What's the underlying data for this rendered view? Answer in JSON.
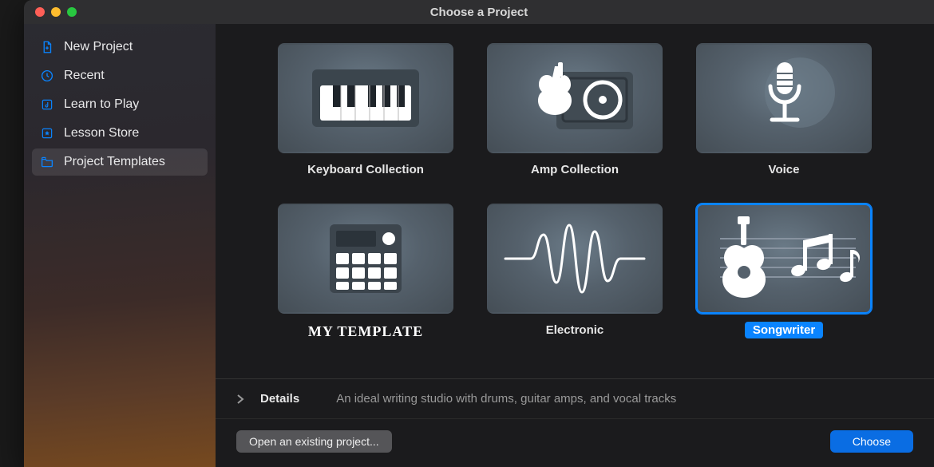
{
  "window": {
    "title": "Choose a Project"
  },
  "sidebar": {
    "items": [
      {
        "label": "New Project"
      },
      {
        "label": "Recent"
      },
      {
        "label": "Learn to Play"
      },
      {
        "label": "Lesson Store"
      },
      {
        "label": "Project Templates"
      }
    ],
    "active_index": 4
  },
  "templates": [
    {
      "label": "Keyboard Collection",
      "icon": "piano-icon"
    },
    {
      "label": "Amp Collection",
      "icon": "amp-icon"
    },
    {
      "label": "Voice",
      "icon": "microphone-icon"
    },
    {
      "label": "MY TEMPLATE",
      "icon": "drum-machine-icon",
      "custom": true
    },
    {
      "label": "Electronic",
      "icon": "waveform-icon"
    },
    {
      "label": "Songwriter",
      "icon": "songwriter-icon",
      "selected": true
    }
  ],
  "details": {
    "label": "Details",
    "description": "An ideal writing studio with drums, guitar amps, and vocal tracks"
  },
  "footer": {
    "open_label": "Open an existing project...",
    "choose_label": "Choose"
  },
  "colors": {
    "accent": "#0a84ff"
  }
}
